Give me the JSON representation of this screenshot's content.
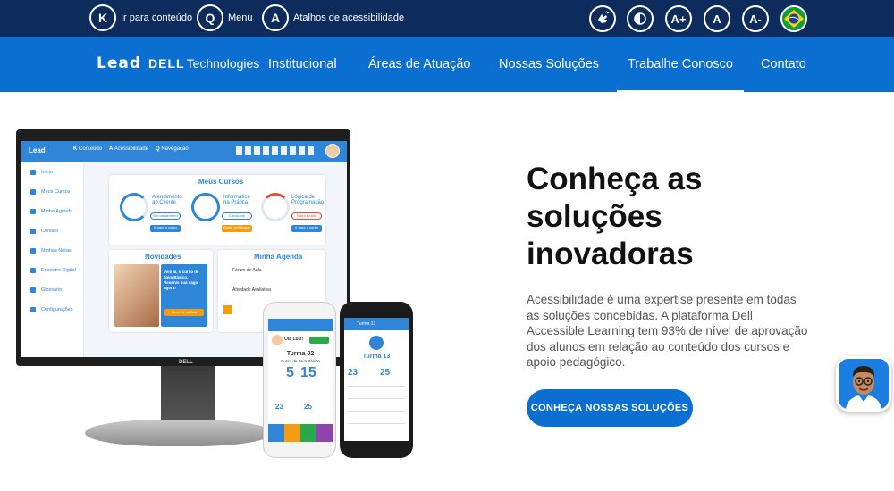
{
  "topbar": {
    "skip_links": [
      {
        "key": "K",
        "label": "Ir para conteúdo"
      },
      {
        "key": "Q",
        "label": "Menu"
      },
      {
        "key": "A",
        "label": "Atalhos de acessibilidade"
      }
    ],
    "accessibility_buttons": [
      {
        "icon": "sign-language-icon",
        "label": ""
      },
      {
        "icon": "contrast-icon",
        "label": ""
      },
      {
        "icon": "font-increase-icon",
        "label": "A+"
      },
      {
        "icon": "font-reset-icon",
        "label": "A"
      },
      {
        "icon": "font-decrease-icon",
        "label": "A-"
      }
    ],
    "language_flag": "brazil-flag-icon"
  },
  "nav": {
    "logo": {
      "lead": "Lead",
      "dell": "DELL",
      "tech": "Technologies"
    },
    "items": [
      "Institucional",
      "Áreas de Atuação",
      "Nossas Soluções",
      "Trabalhe Conosco",
      "Contato"
    ],
    "active_index": 3
  },
  "hero": {
    "title_lines": [
      "Conheça as",
      "soluções",
      "inovadoras"
    ],
    "description": "Acessibilidade é uma expertise presente em todas as soluções concebidas. A plataforma Dell Accessible Learning tem 93% de nível de aprovação dos alunos em relação ao conteúdo dos cursos e apoio pedagógico.",
    "cta_label": "CONHEÇA NOSSAS SOLUÇÕES"
  },
  "mockup": {
    "monitor_brand": "DELL",
    "top_shortcuts": [
      {
        "key": "K",
        "label": "Conteúdo"
      },
      {
        "key": "A",
        "label": "Acessibilidade"
      },
      {
        "key": "Q",
        "label": "Navegação"
      }
    ],
    "sidebar": [
      "Início",
      "Meus Cursos",
      "Minha Agenda",
      "Contato",
      "Minhas Notas",
      "Encontro Digital",
      "Glossário",
      "Configurações"
    ],
    "section_courses": "Meus Cursos",
    "courses": [
      {
        "name": "Atendimento ao Cliente",
        "status": "Em andamento",
        "button": "Ir para o curso"
      },
      {
        "name": "Informática na Prática",
        "status": "Concluído",
        "button": "Emitir certificado"
      },
      {
        "name": "Lógica de Programação",
        "status": "Não iniciado",
        "button": "Ir para o curso"
      }
    ],
    "section_news": "Novidades",
    "news_text": "Vem aí, o curso de Java Básico. Reserve sua vaga agora!",
    "news_button": "Quero ir na lista",
    "section_agenda": "Minha Agenda",
    "agenda": [
      "Fórum de Aula",
      "Atividade Avaliativa"
    ],
    "phone_white": {
      "greeting": "Olá Luiz!",
      "class": "Turma 02",
      "course": "Curso de Java Básico",
      "big_left": "5",
      "big_right": "15",
      "stat_a": "23",
      "stat_b": "25"
    },
    "phone_black": {
      "header": "Turma 13",
      "class": "Turma 13",
      "stat_a": "23",
      "stat_b": "25"
    }
  }
}
